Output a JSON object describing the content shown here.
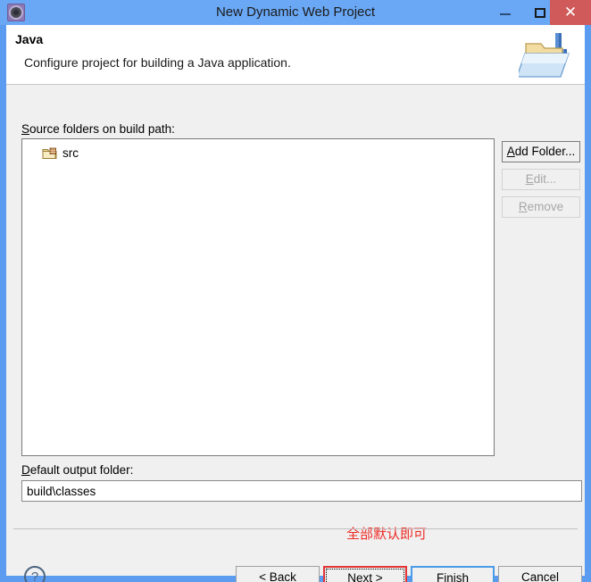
{
  "window": {
    "title": "New Dynamic Web Project",
    "app_icon": "gear-icon",
    "controls": {
      "minimize": "–",
      "maximize": "□",
      "close": "✕",
      "close_color": "#d05a5a"
    },
    "border_color": "#5b9bf0",
    "titlebar_color": "#6aa8f5"
  },
  "header": {
    "title": "Java",
    "description": "Configure project for building a Java application.",
    "icon": "java-folder-icon"
  },
  "source_section": {
    "label": "Source folders on build path:",
    "label_mnemonic": "S",
    "items": [
      {
        "name": "src",
        "icon": "source-folder-icon"
      }
    ],
    "buttons": [
      {
        "label": "Add Folder...",
        "mnemonic": "A",
        "enabled": true
      },
      {
        "label": "Edit...",
        "mnemonic": "E",
        "enabled": false
      },
      {
        "label": "Remove",
        "mnemonic": "R",
        "enabled": false
      }
    ]
  },
  "output_section": {
    "label": "Default output folder:",
    "label_mnemonic": "D",
    "value": "build\\classes",
    "placeholder": ""
  },
  "annotation": {
    "text": "全部默认即可",
    "color": "#ee2a24"
  },
  "footer": {
    "help_icon": "question-mark-icon",
    "buttons": [
      {
        "label": "< Back",
        "mnemonic": "B",
        "state": "normal"
      },
      {
        "label": "Next >",
        "mnemonic": "N",
        "state": "focused-highlighted",
        "highlight_color": "#e33434"
      },
      {
        "label": "Finish",
        "mnemonic": "F",
        "state": "default",
        "border_color": "#4a9be8"
      },
      {
        "label": "Cancel",
        "mnemonic": "C",
        "state": "normal"
      }
    ]
  }
}
